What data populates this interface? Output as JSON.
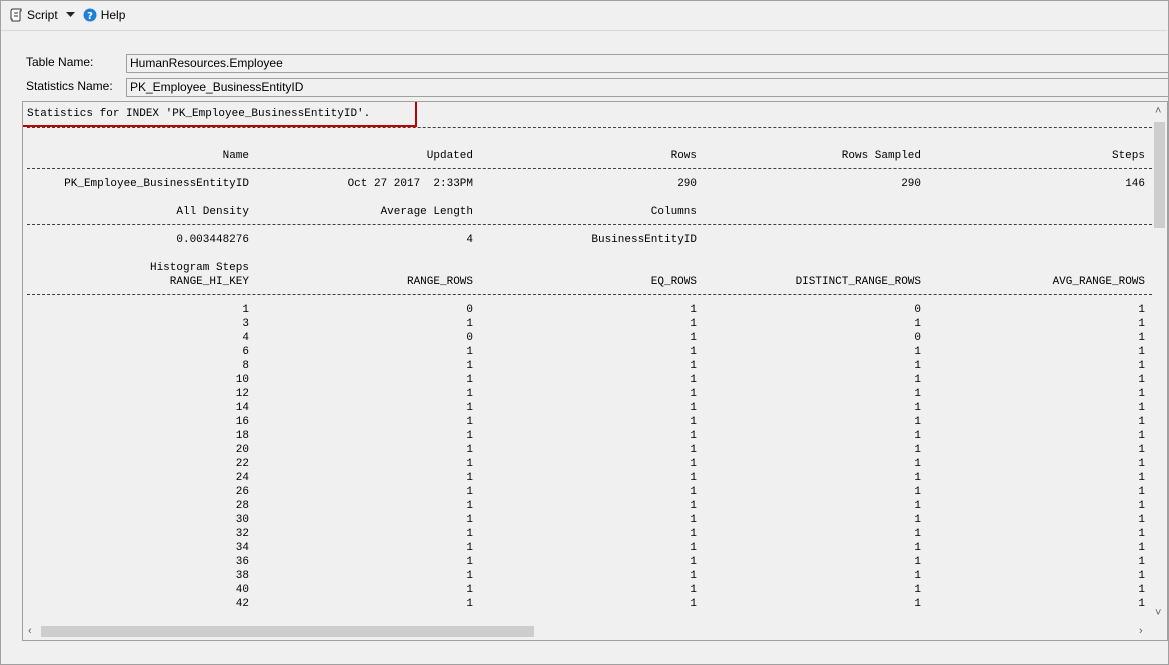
{
  "toolbar": {
    "script_label": "Script",
    "help_label": "Help"
  },
  "form": {
    "table_name_label": "Table Name:",
    "table_name_value": "HumanResources.Employee",
    "stats_name_label": "Statistics Name:",
    "stats_name_value": "PK_Employee_BusinessEntityID"
  },
  "results": {
    "heading": "Statistics for INDEX 'PK_Employee_BusinessEntityID'.",
    "header1": {
      "name": "Name",
      "updated": "Updated",
      "rows": "Rows",
      "rows_sampled": "Rows Sampled",
      "steps": "Steps"
    },
    "row1": {
      "name": "PK_Employee_BusinessEntityID",
      "updated": "Oct 27 2017  2:33PM",
      "rows": "290",
      "rows_sampled": "290",
      "steps": "146"
    },
    "header2": {
      "all_density": "All Density",
      "avg_length": "Average Length",
      "columns": "Columns"
    },
    "row2": {
      "all_density": "0.003448276",
      "avg_length": "4",
      "columns": "BusinessEntityID"
    },
    "histogram_title": "Histogram Steps",
    "header3": {
      "range_hi_key": "RANGE_HI_KEY",
      "range_rows": "RANGE_ROWS",
      "eq_rows": "EQ_ROWS",
      "distinct_range_rows": "DISTINCT_RANGE_ROWS",
      "avg_range_rows": "AVG_RANGE_ROWS"
    },
    "histogram": [
      [
        "1",
        "0",
        "1",
        "0",
        "1"
      ],
      [
        "3",
        "1",
        "1",
        "1",
        "1"
      ],
      [
        "4",
        "0",
        "1",
        "0",
        "1"
      ],
      [
        "6",
        "1",
        "1",
        "1",
        "1"
      ],
      [
        "8",
        "1",
        "1",
        "1",
        "1"
      ],
      [
        "10",
        "1",
        "1",
        "1",
        "1"
      ],
      [
        "12",
        "1",
        "1",
        "1",
        "1"
      ],
      [
        "14",
        "1",
        "1",
        "1",
        "1"
      ],
      [
        "16",
        "1",
        "1",
        "1",
        "1"
      ],
      [
        "18",
        "1",
        "1",
        "1",
        "1"
      ],
      [
        "20",
        "1",
        "1",
        "1",
        "1"
      ],
      [
        "22",
        "1",
        "1",
        "1",
        "1"
      ],
      [
        "24",
        "1",
        "1",
        "1",
        "1"
      ],
      [
        "26",
        "1",
        "1",
        "1",
        "1"
      ],
      [
        "28",
        "1",
        "1",
        "1",
        "1"
      ],
      [
        "30",
        "1",
        "1",
        "1",
        "1"
      ],
      [
        "32",
        "1",
        "1",
        "1",
        "1"
      ],
      [
        "34",
        "1",
        "1",
        "1",
        "1"
      ],
      [
        "36",
        "1",
        "1",
        "1",
        "1"
      ],
      [
        "38",
        "1",
        "1",
        "1",
        "1"
      ],
      [
        "40",
        "1",
        "1",
        "1",
        "1"
      ],
      [
        "42",
        "1",
        "1",
        "1",
        "1"
      ]
    ]
  },
  "colors": {
    "highlight_border": "#c00000",
    "help_icon": "#1e7fd8"
  },
  "icons": {
    "script": "script-icon",
    "dropdown": "chevron-down-icon",
    "help": "help-icon"
  }
}
